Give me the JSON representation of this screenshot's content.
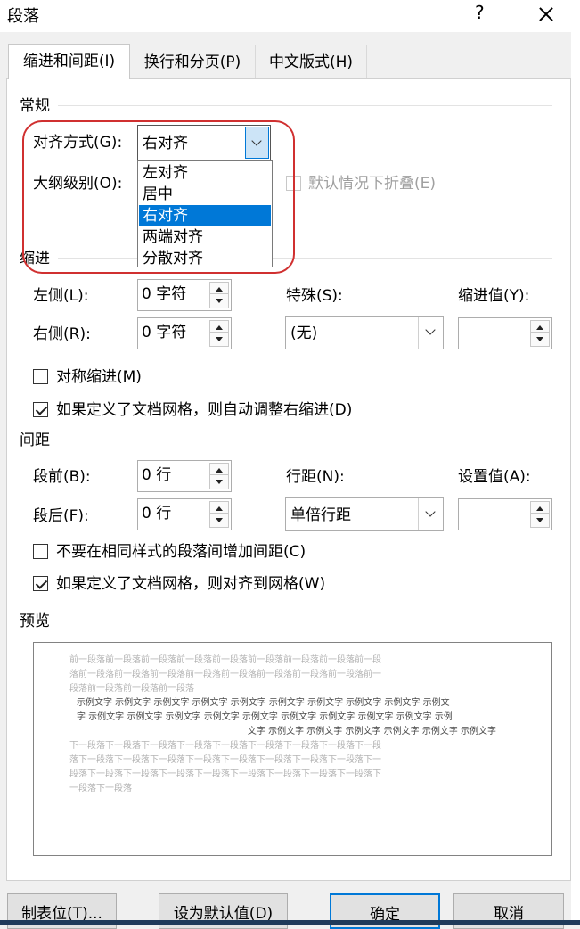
{
  "window": {
    "title": "段落",
    "help": "?"
  },
  "tabs": [
    {
      "label": "缩进和间距(I)"
    },
    {
      "label": "换行和分页(P)"
    },
    {
      "label": "中文版式(H)"
    }
  ],
  "general": {
    "heading": "常规",
    "alignment_label": "对齐方式(G):",
    "alignment_value": "右对齐",
    "outline_label": "大纲级别(O):",
    "collapse_label": "默认情况下折叠(E)",
    "alignment_options": [
      "左对齐",
      "居中",
      "右对齐",
      "两端对齐",
      "分散对齐"
    ],
    "selected_index": 2
  },
  "indent": {
    "heading": "缩进",
    "left_label": "左侧(L):",
    "left_value": "0 字符",
    "right_label": "右侧(R):",
    "right_value": "0 字符",
    "special_label": "特殊(S):",
    "special_value": "(无)",
    "by_label": "缩进值(Y):",
    "by_value": "",
    "mirror_label": "对称缩进(M)",
    "mirror_checked": false,
    "grid_label": "如果定义了文档网格，则自动调整右缩进(D)",
    "grid_checked": true
  },
  "spacing": {
    "heading": "间距",
    "before_label": "段前(B):",
    "before_value": "0 行",
    "after_label": "段后(F):",
    "after_value": "0 行",
    "line_label": "行距(N):",
    "line_value": "单倍行距",
    "at_label": "设置值(A):",
    "at_value": "",
    "no_space_label": "不要在相同样式的段落间增加间距(C)",
    "no_space_checked": false,
    "snap_label": "如果定义了文档网格，则对齐到网格(W)",
    "snap_checked": true
  },
  "preview": {
    "heading": "预览",
    "prev_lines": [
      "前一段落前一段落前一段落前一段落前一段落前一段落前一段落前一段落前一段",
      "落前一段落前一段落前一段落前一段落前一段落前一段落前一段落前一段落前一",
      "段落前一段落前一段落前一段落"
    ],
    "sample_lines": [
      "示例文字 示例文字 示例文字 示例文字 示例文字 示例文字 示例文字 示例文字 示例文字 示例文",
      "字 示例文字 示例文字 示例文字 示例文字 示例文字 示例文字 示例文字 示例文字 示例文字 示例",
      "文字 示例文字 示例文字 示例文字 示例文字 示例文字 示例文字"
    ],
    "next_lines": [
      "下一段落下一段落下一段落下一段落下一段落下一段落下一段落下一段落下一段",
      "落下一段落下一段落下一段落下一段落下一段落下一段落下一段落下一段落下一",
      "段落下一段落下一段落下一段落下一段落下一段落下一段落下一段落下一段落下",
      "一段落下一段落"
    ]
  },
  "buttons": {
    "tabs": "制表位(T)...",
    "set_default": "设为默认值(D)",
    "ok": "确定",
    "cancel": "取消"
  },
  "colors": {
    "selection": "#0078d7",
    "highlight_ring": "#d03030"
  }
}
